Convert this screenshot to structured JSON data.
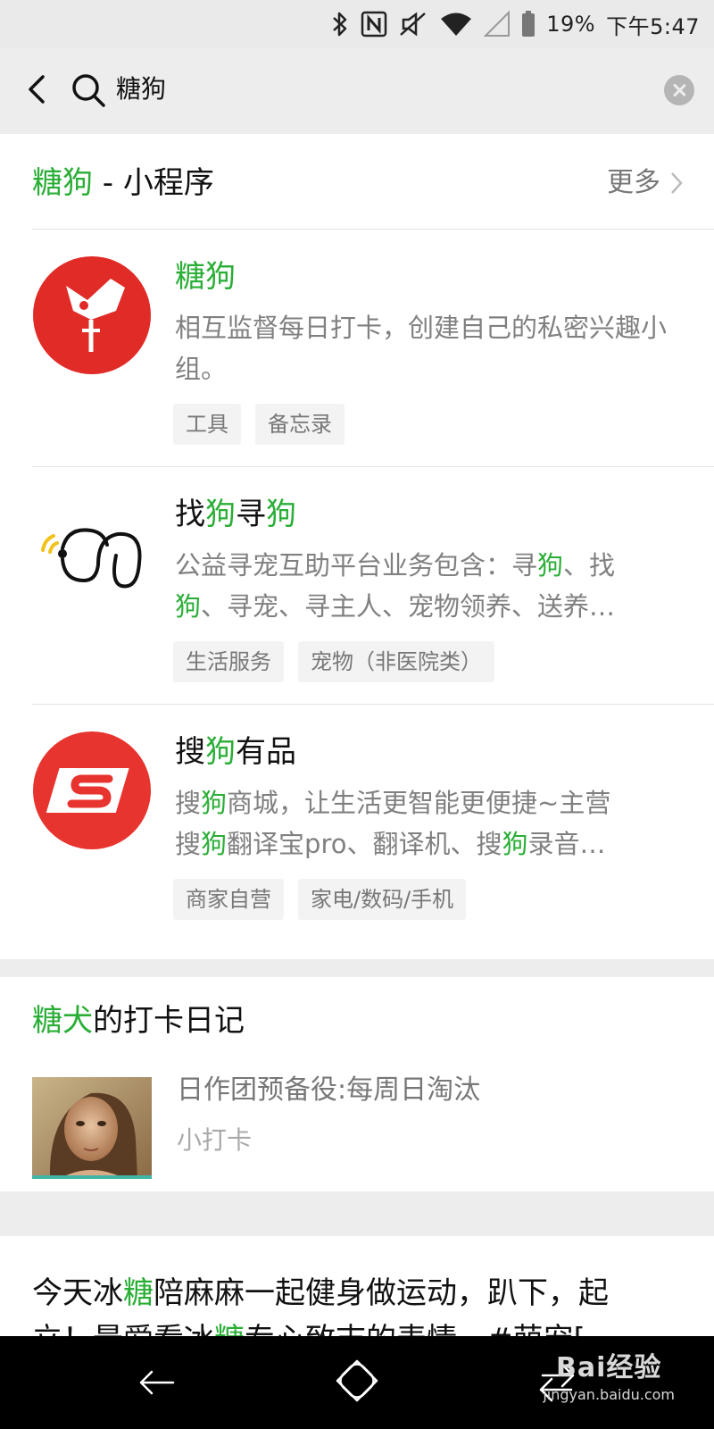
{
  "status_bar": {
    "battery": "19%",
    "time": "下午5:47"
  },
  "search": {
    "query": "糖狗"
  },
  "mini_programs": {
    "header_highlight": "糖狗",
    "header_rest": " - 小程序",
    "more_label": "更多",
    "items": [
      {
        "title_parts": [
          "糖狗"
        ],
        "desc": "相互监督每日打卡，创建自己的私密兴趣小组。",
        "tags": [
          "工具",
          "备忘录"
        ],
        "logo": "red-flag-logo-icon"
      },
      {
        "title_parts": [
          "找",
          "狗",
          "寻",
          "狗"
        ],
        "desc_line1_parts": [
          "公益寻宠互助平台业务包含：寻",
          "狗",
          "、找"
        ],
        "desc_line2_parts": [
          "狗",
          "、寻宠、寻主人、宠物领养、送养…"
        ],
        "tags": [
          "生活服务",
          "宠物（非医院类）"
        ],
        "logo": "dog-outline-logo-icon"
      },
      {
        "title_parts": [
          "搜",
          "狗",
          "有品"
        ],
        "desc_line1_parts": [
          "搜",
          "狗",
          "商城，让生活更智能更便捷~主营"
        ],
        "desc_line2_parts": [
          "搜",
          "狗",
          "翻译宝pro、翻译机、搜",
          "狗",
          "录音…"
        ],
        "tags": [
          "商家自营",
          "家电/数码/手机"
        ],
        "logo": "sogou-s-logo-icon"
      }
    ]
  },
  "diary": {
    "header_highlight": "糖犬",
    "header_rest": "的打卡日记",
    "title": "日作团预备役:每周日淘汰",
    "subtitle": "小打卡"
  },
  "article": {
    "line1_parts": [
      "今天冰",
      "糖",
      "陪麻麻一起健身做运动，趴下，起"
    ],
    "line2_parts": [
      "立！最爱看冰",
      "糖",
      "专心致志的表情。#萌宠["
    ]
  },
  "watermark": {
    "top": "Bai经验",
    "bottom": "jingyan.baidu.com"
  },
  "colors": {
    "highlight": "#2aae36",
    "logo_red": "#e02b27"
  }
}
